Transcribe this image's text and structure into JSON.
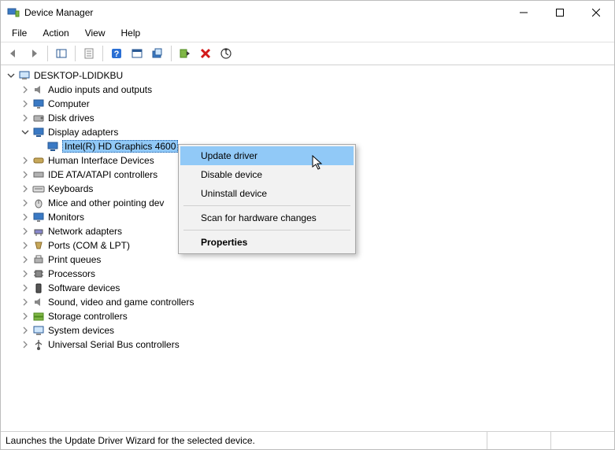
{
  "window": {
    "title": "Device Manager"
  },
  "menu": {
    "file": "File",
    "action": "Action",
    "view": "View",
    "help": "Help"
  },
  "tree": {
    "root": "DESKTOP-LDIDKBU",
    "audio": "Audio inputs and outputs",
    "computer": "Computer",
    "disk": "Disk drives",
    "display": "Display adapters",
    "display_child": "Intel(R) HD Graphics 4600",
    "hid": "Human Interface Devices",
    "ide": "IDE ATA/ATAPI controllers",
    "keyboards": "Keyboards",
    "mice": "Mice and other pointing dev",
    "monitors": "Monitors",
    "network": "Network adapters",
    "ports": "Ports (COM & LPT)",
    "printq": "Print queues",
    "processors": "Processors",
    "software": "Software devices",
    "sound": "Sound, video and game controllers",
    "storage": "Storage controllers",
    "system": "System devices",
    "usb": "Universal Serial Bus controllers"
  },
  "context": {
    "update": "Update driver",
    "disable": "Disable device",
    "uninstall": "Uninstall device",
    "scan": "Scan for hardware changes",
    "properties": "Properties"
  },
  "status": {
    "text": "Launches the Update Driver Wizard for the selected device."
  }
}
